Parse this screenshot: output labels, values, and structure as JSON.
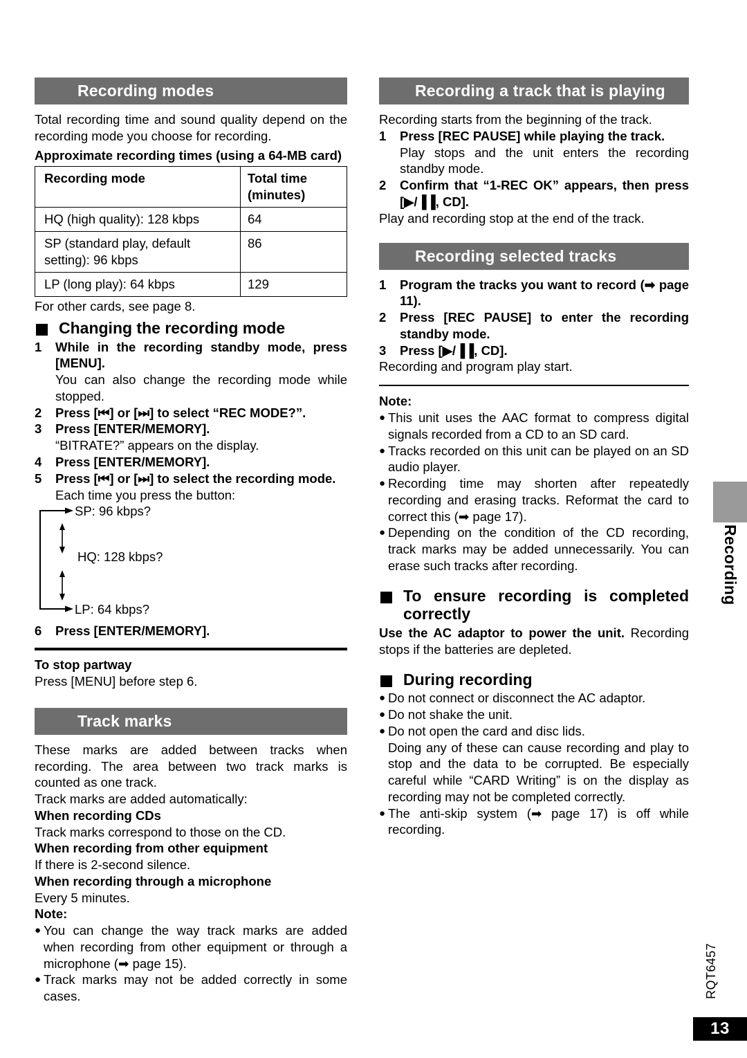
{
  "document": {
    "page_number": "13",
    "doc_code": "RQT6457",
    "side_tab_label": "Recording"
  },
  "left_column": {
    "section_recording_modes": {
      "title": "Recording modes",
      "intro": "Total recording time and sound quality depend on the recording mode you choose for recording.",
      "table_caption": "Approximate recording times (using a 64-MB card)",
      "table": {
        "headers": [
          "Recording mode",
          "Total time (minutes)"
        ],
        "header_col1": "Recording mode",
        "header_col2_line1": "Total time",
        "header_col2_line2": "(minutes)",
        "rows": [
          {
            "mode": "HQ (high quality):  128 kbps",
            "time": "64"
          },
          {
            "mode": "SP (standard play, default setting):  96 kbps",
            "time": "86"
          },
          {
            "mode": "LP (long play):  64 kbps",
            "time": "129"
          }
        ]
      },
      "after_table": "For other cards, see page 8."
    },
    "subsection_changing_mode": {
      "heading": "Changing the recording mode",
      "steps": [
        {
          "num": "1",
          "bold": "While in the recording standby mode, press [MENU].",
          "note": "You can also change the recording mode while stopped."
        },
        {
          "num": "2",
          "bold": "Press [⏮] or [⏭] to select “REC MODE?”.",
          "note": ""
        },
        {
          "num": "3",
          "bold": "Press [ENTER/MEMORY].",
          "note": "“BITRATE?” appears on the display."
        },
        {
          "num": "4",
          "bold": "Press [ENTER/MEMORY].",
          "note": ""
        },
        {
          "num": "5",
          "bold": "Press [⏮] or [⏭] to select the recording mode.",
          "note": "Each time you press the button:"
        },
        {
          "num": "6",
          "bold": "Press [ENTER/MEMORY].",
          "note": ""
        }
      ],
      "flow_diagram": {
        "items": [
          "SP:  96 kbps?",
          "HQ:  128 kbps?",
          "LP:  64 kbps?"
        ]
      },
      "stop_partway_heading": "To stop partway",
      "stop_partway_text": "Press [MENU] before step 6."
    },
    "section_track_marks": {
      "title": "Track marks",
      "para1": "These marks are added between tracks when recording. The area between two track marks is counted as one track.",
      "para2": "Track marks are added automatically:",
      "sub1_heading": "When recording CDs",
      "sub1_text": "Track marks correspond to those on the CD.",
      "sub2_heading": "When recording from other equipment",
      "sub2_text": "If there is 2-second silence.",
      "sub3_heading": "When recording through a microphone",
      "sub3_text": "Every 5 minutes.",
      "note_label": "Note:",
      "notes": [
        "You can change the way track marks are added when recording from other equipment or through a microphone (➡ page 15).",
        "Track marks may not be added correctly in some cases."
      ]
    }
  },
  "right_column": {
    "section_recording_playing_track": {
      "title": "Recording a track that is playing",
      "intro": "Recording starts from the beginning of the track.",
      "steps": [
        {
          "num": "1",
          "bold": "Press [REC PAUSE] while playing the track.",
          "note": "Play stops and the unit enters the recording standby mode."
        },
        {
          "num": "2",
          "bold": "Confirm that “1-REC OK” appears, then press [▶/▐▐, CD].",
          "note": ""
        }
      ],
      "after_steps": "Play and recording stop at the end of the track."
    },
    "section_recording_selected_tracks": {
      "title": "Recording selected tracks",
      "steps": [
        {
          "num": "1",
          "bold": "Program the tracks you want to record (➡ page 11).",
          "note": ""
        },
        {
          "num": "2",
          "bold": "Press [REC PAUSE] to enter the recording standby mode.",
          "note": ""
        },
        {
          "num": "3",
          "bold": "Press [▶/▐▐, CD].",
          "note": ""
        }
      ],
      "after_steps": "Recording and program play start."
    },
    "note_block": {
      "note_label": "Note:",
      "notes": [
        "This unit uses the AAC format to compress digital signals recorded from a CD to an SD card.",
        "Tracks recorded on this unit can be played on an SD audio player.",
        "Recording time may shorten after repeatedly recording and erasing tracks. Reformat the card to correct this (➡ page 17).",
        "Depending on the condition of the CD recording, track marks may be added unnecessarily. You can erase such tracks after recording."
      ]
    },
    "subsection_ensure_completed": {
      "heading": "To ensure recording is completed correctly",
      "bold_lead": "Use the AC adaptor to power the unit.",
      "rest": " Recording stops if the batteries are depleted."
    },
    "subsection_during_recording": {
      "heading": "During recording",
      "bullets": [
        "Do not connect or disconnect the AC adaptor.",
        "Do not shake the unit.",
        "Do not open the card and disc lids."
      ],
      "continuation": "Doing any of these can cause recording and play to stop and the data to be corrupted. Be especially careful while “CARD Writing” is on the display as recording may not be completed correctly.",
      "last_bullet": "The anti-skip system (➡ page 17) is off while recording."
    }
  },
  "colors": {
    "section_bar": "#6e6e6e",
    "side_tab_block": "#9a9a9a",
    "page_badge": "#000000",
    "text": "#000000",
    "background": "#ffffff"
  }
}
